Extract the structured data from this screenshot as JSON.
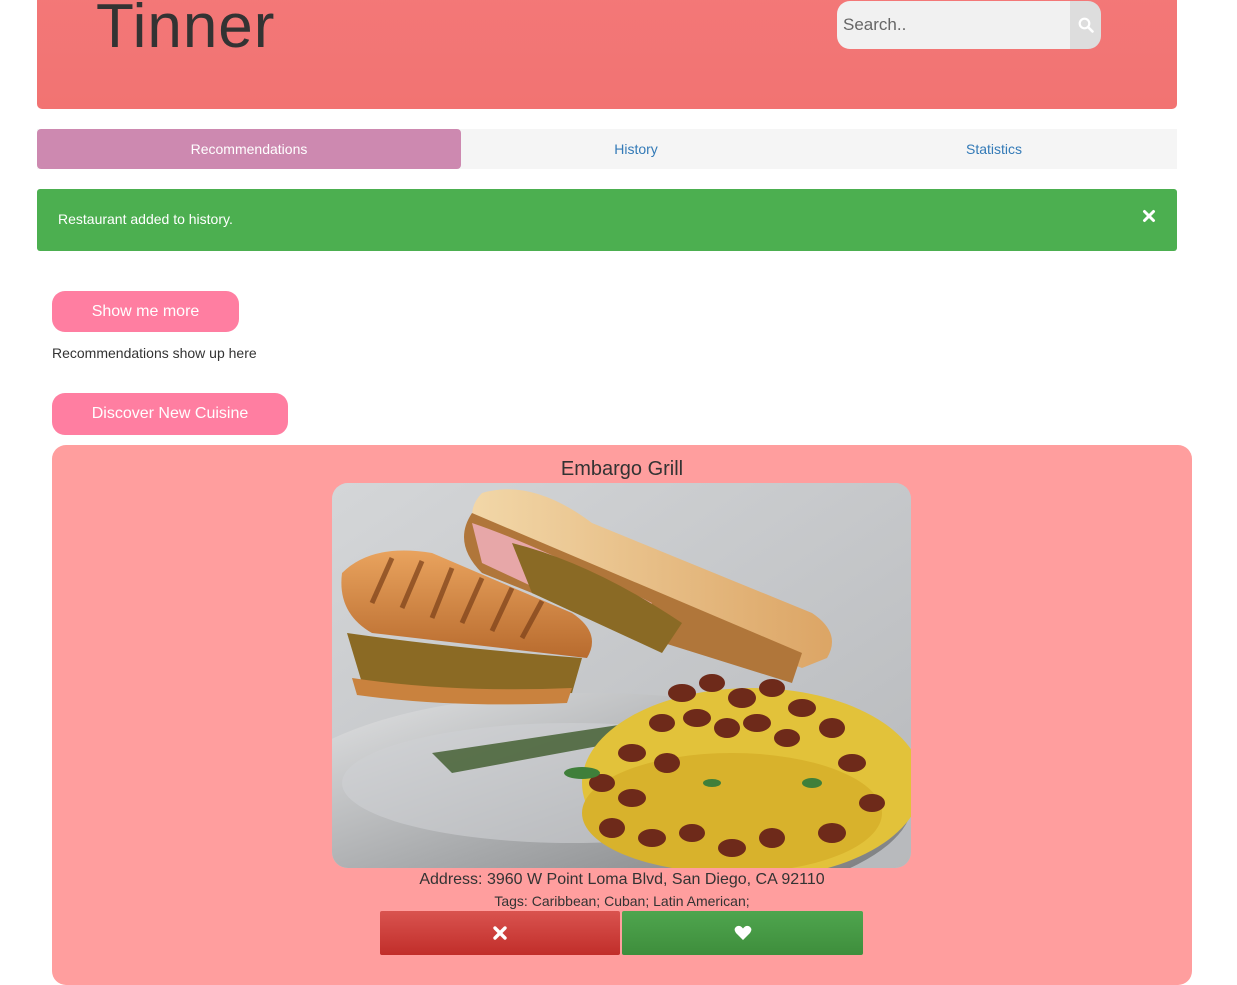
{
  "app": {
    "brand": "Tinner"
  },
  "search": {
    "placeholder": "Search..",
    "icon": "search-icon"
  },
  "nav": {
    "tabs": [
      {
        "label": "Recommendations",
        "active": true
      },
      {
        "label": "History",
        "active": false
      },
      {
        "label": "Statistics",
        "active": false
      }
    ]
  },
  "alert": {
    "message": "Restaurant added to history.",
    "close_icon": "close-icon"
  },
  "actions": {
    "show_more": "Show me more",
    "placeholder_note": "Recommendations show up here",
    "discover": "Discover New Cuisine"
  },
  "restaurant": {
    "name": "Embargo Grill",
    "address": "Address: 3960 W Point Loma Blvd, San Diego, CA 92110",
    "tags": "Tags: Caribbean; Cuban; Latin American;",
    "dislike_icon": "close-icon",
    "like_icon": "heart-icon"
  },
  "colors": {
    "header": "#f27372",
    "active_tab": "#cd89b0",
    "alert": "#4caf50",
    "pill_button": "#ff7ea1",
    "card": "#ff9e9e",
    "dislike": "#d9534f",
    "like": "#449d44"
  }
}
